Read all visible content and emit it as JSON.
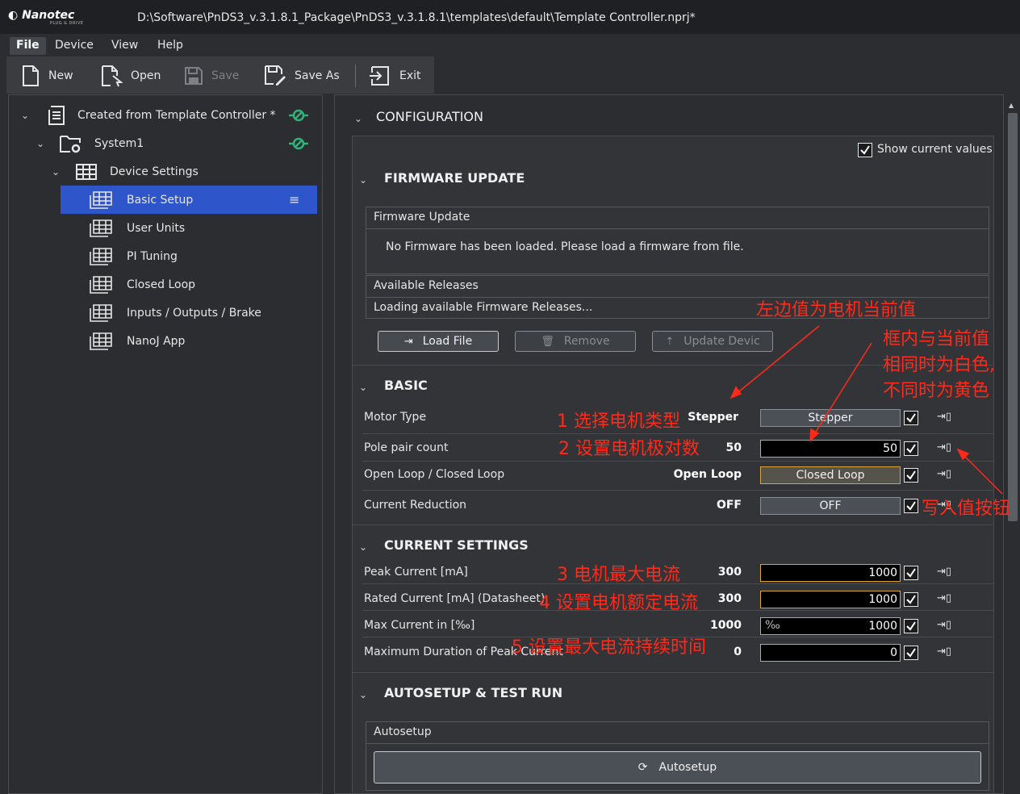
{
  "window": {
    "logo": "Nanotec",
    "logo_sub": "PLUG & DRIVE",
    "title": "D:\\Software\\PnDS3_v.3.1.8.1_Package\\PnDS3_v.3.1.8.1\\templates\\default\\Template Controller.nprj*"
  },
  "menu": [
    "File",
    "Device",
    "View",
    "Help"
  ],
  "toolbar": {
    "new": "New",
    "open": "Open",
    "save": "Save",
    "save_as": "Save As",
    "exit": "Exit"
  },
  "tree": {
    "root": "Created from Template Controller *",
    "system": "System1",
    "device_settings": "Device Settings",
    "items": [
      "Basic Setup",
      "User Units",
      "PI Tuning",
      "Closed Loop",
      "Inputs / Outputs / Brake",
      "NanoJ App"
    ]
  },
  "config": {
    "title": "CONFIGURATION",
    "show_current_values": "Show current values",
    "firmware": {
      "title": "FIRMWARE UPDATE",
      "box_title": "Firmware Update",
      "message": "No Firmware has been loaded. Please load a firmware from file.",
      "releases_title": "Available Releases",
      "releases_status": "Loading available Firmware Releases...",
      "load_file": "Load File",
      "remove": "Remove",
      "update_device": "Update Devic"
    },
    "basic": {
      "title": "BASIC",
      "rows": [
        {
          "label": "Motor Type",
          "current": "Stepper",
          "value": "Stepper"
        },
        {
          "label": "Pole pair count",
          "current": "50",
          "value": "50"
        },
        {
          "label": "Open Loop / Closed Loop",
          "current": "Open Loop",
          "value": "Closed Loop"
        },
        {
          "label": "Current Reduction",
          "current": "OFF",
          "value": "OFF"
        }
      ]
    },
    "current_settings": {
      "title": "CURRENT SETTINGS",
      "rows": [
        {
          "label": "Peak Current [mA]",
          "current": "300",
          "value": "1000"
        },
        {
          "label": "Rated Current [mA] (Datasheet)",
          "current": "300",
          "value": "1000"
        },
        {
          "label": "Max Current in  [‰]",
          "current": "1000",
          "value": "1000",
          "unit": "‰"
        },
        {
          "label": "Maximum Duration of Peak Current",
          "current": "0",
          "value": "0"
        }
      ]
    },
    "autosetup": {
      "title": "AUTOSETUP & TEST RUN",
      "box_title": "Autosetup",
      "button": "Autosetup"
    }
  },
  "annotations": {
    "left_value": "左边值为电机当前值",
    "box_color_1": "框内与当前值",
    "box_color_2": "相同时为白色,",
    "box_color_3": "不同时为黄色",
    "step1": "1 选择电机类型",
    "step2": "2 设置电机极对数",
    "write_button": "写入值按钮",
    "step3": "3 电机最大电流",
    "step4": "4 设置电机额定电流",
    "step5": "5 设置最大电流持续时间"
  },
  "colors": {
    "accent_blue": "#2e55c9",
    "annotation_red": "#ff2a1a",
    "highlight_yellow": "#d9a23a",
    "link_green": "#2fb37a"
  }
}
